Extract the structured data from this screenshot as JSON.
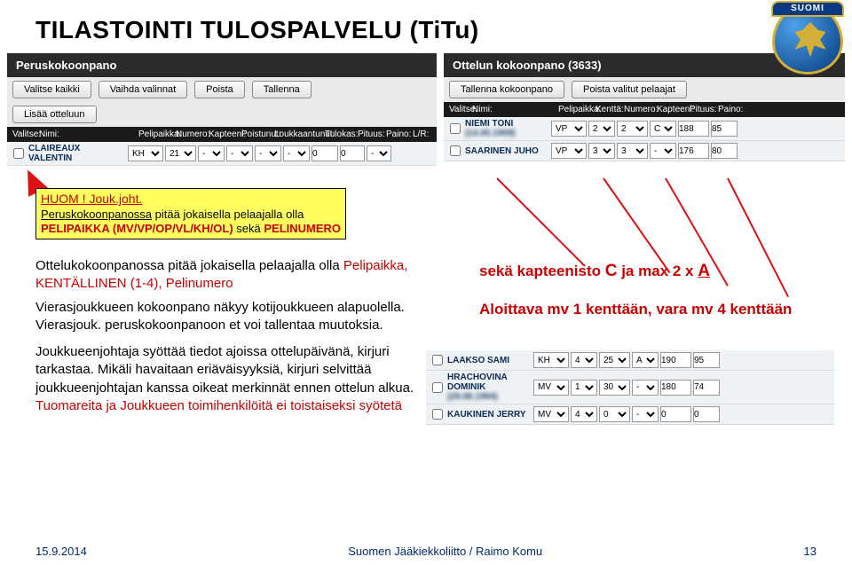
{
  "title": "TILASTOINTI TULOSPALVELU  (TiTu)",
  "logo_text": "SUOMI",
  "panels": {
    "left": {
      "header": "Peruskokoonpano",
      "buttons_row1": [
        "Valitse kaikki",
        "Vaihda valinnat",
        "Poista",
        "Tallenna"
      ],
      "buttons_row2": [
        "Lisää otteluun"
      ],
      "cols": [
        "Valitse:",
        "Nimi:",
        "Pelipaikka:",
        "Numero:",
        "Kapteeni:",
        "Poistunut:",
        "Loukkaantunut:",
        "Tulokas:",
        "Pituus:",
        "Paino:",
        "L/R:"
      ],
      "rows": [
        {
          "name": "CLAIREAUX VALENTIN",
          "pp": "KH",
          "num": "21",
          "kap": "-",
          "pois": "-",
          "louk": "-",
          "tul": "-",
          "pit": "0",
          "pai": "0",
          "lr": "-"
        }
      ]
    },
    "right": {
      "header": "Ottelun kokoonpano (3633)",
      "buttons": [
        "Tallenna kokoonpano",
        "Poista valitut pelaajat"
      ],
      "cols": [
        "Valitse:",
        "Nimi:",
        "Pelipaikka:",
        "Kenttä:",
        "Numero:",
        "Kapteeni:",
        "Pituus:",
        "Paino:"
      ],
      "rows": [
        {
          "name": "NIEMI TONI",
          "sub": "(14.00.1909)",
          "pp": "VP",
          "k": "2",
          "num": "2",
          "kap": "C",
          "pit": "188",
          "pai": "85"
        },
        {
          "name": "SAARINEN JUHO",
          "sub": "",
          "pp": "VP",
          "k": "3",
          "num": "3",
          "kap": "-",
          "pit": "176",
          "pai": "80"
        }
      ]
    }
  },
  "note": {
    "line1": "HUOM !  Jouk.joht.",
    "line2a": "Peruskokoonpanossa",
    "line2b": " pitää jokaisella pelaajalla olla",
    "line3a": "PELIPAIKKA (MV/VP/OP/VL/KH/OL)",
    "line3b": " sekä ",
    "line3c": "PELINUMERO"
  },
  "body": {
    "p1a": "Ottelukokoonpanossa pitää jokaisella pelaajalla olla ",
    "p1b": "Pelipaikka, KENTÄLLINEN (1-4), Pelinumero",
    "p2a": "Vierasjoukkueen kokoonpano näkyy kotijoukkueen alapuolella. Vierasjouk. peruskokoonpanoon et voi tallentaa muutoksia.",
    "p3a": "Joukkueenjohtaja syöttää tiedot ajoissa ottelupäivänä, kirjuri tarkastaa. Mikäli havaitaan eriäväisyyksiä, kirjuri selvittää joukkueenjohtajan kanssa oikeat merkinnät ennen ottelun alkua.",
    "p3b": "Tuomareita ja Joukkueen toimihenkilöitä ei toistaiseksi syötetä"
  },
  "rightnotes": {
    "a1": "sekä kapteenisto ",
    "a2": "C",
    "a3": " ja max 2 x  ",
    "a4": "A",
    "b": "Aloittava mv 1 kenttään, vara mv 4 kenttään"
  },
  "rtable": {
    "rows": [
      {
        "name": "LAAKSO SAMI",
        "pp": "KH",
        "k": "4",
        "num": "25",
        "kap": "A",
        "pit": "190",
        "pai": "95"
      },
      {
        "name": "HRACHOVINA DOMINIK",
        "sub": "(29.08.1994)",
        "pp": "MV",
        "k": "1",
        "num": "30",
        "kap": "-",
        "pit": "180",
        "pai": "74"
      },
      {
        "name": "KAUKINEN JERRY",
        "pp": "MV",
        "k": "4",
        "num": "0",
        "kap": "-",
        "pit": "0",
        "pai": "0"
      }
    ]
  },
  "footer": {
    "left": "15.9.2014",
    "mid": "Suomen Jääkiekkoliitto / Raimo Komu",
    "right": "13"
  }
}
